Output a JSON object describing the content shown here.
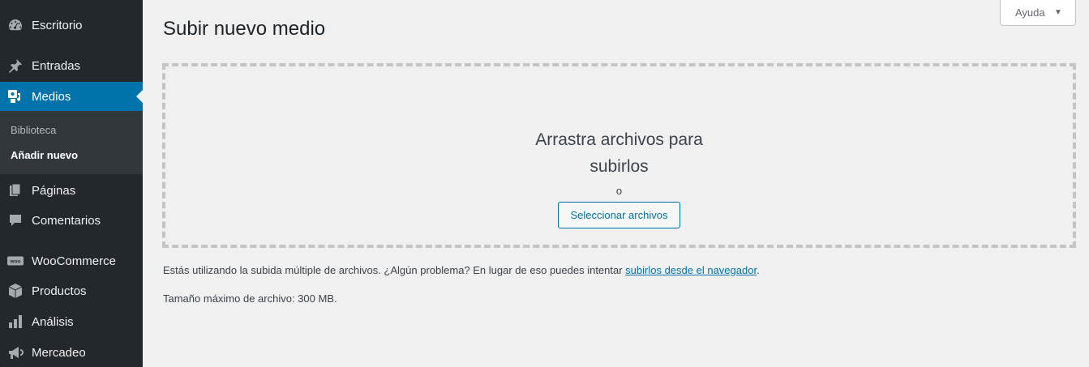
{
  "sidebar": {
    "items": [
      {
        "label": "Escritorio",
        "icon": "dashboard-icon"
      },
      {
        "label": "Entradas",
        "icon": "pushpin-icon"
      },
      {
        "label": "Medios",
        "icon": "media-icon"
      },
      {
        "label": "Páginas",
        "icon": "pages-icon"
      },
      {
        "label": "Comentarios",
        "icon": "comments-icon"
      },
      {
        "label": "WooCommerce",
        "icon": "woocommerce-icon"
      },
      {
        "label": "Productos",
        "icon": "products-icon"
      },
      {
        "label": "Análisis",
        "icon": "analytics-icon"
      },
      {
        "label": "Mercadeo",
        "icon": "megaphone-icon"
      }
    ],
    "submenu": [
      "Biblioteca",
      "Añadir nuevo"
    ]
  },
  "header": {
    "help_label": "Ayuda",
    "help_caret": "▼"
  },
  "main": {
    "title": "Subir nuevo medio",
    "drop_line1": "Arrastra archivos para",
    "drop_line2": "subirlos",
    "drop_or": "o",
    "select_button": "Seleccionar archivos",
    "notice_text": "Estás utilizando la subida múltiple de archivos. ¿Algún problema? En lugar de eso puedes intentar ",
    "notice_link": "subirlos desde el navegador",
    "notice_end": ".",
    "max_size": "Tamaño máximo de archivo: 300 MB."
  },
  "colors": {
    "sidebar_bg": "#23282d",
    "active_bg": "#0073aa",
    "accent": "#0071a1"
  }
}
